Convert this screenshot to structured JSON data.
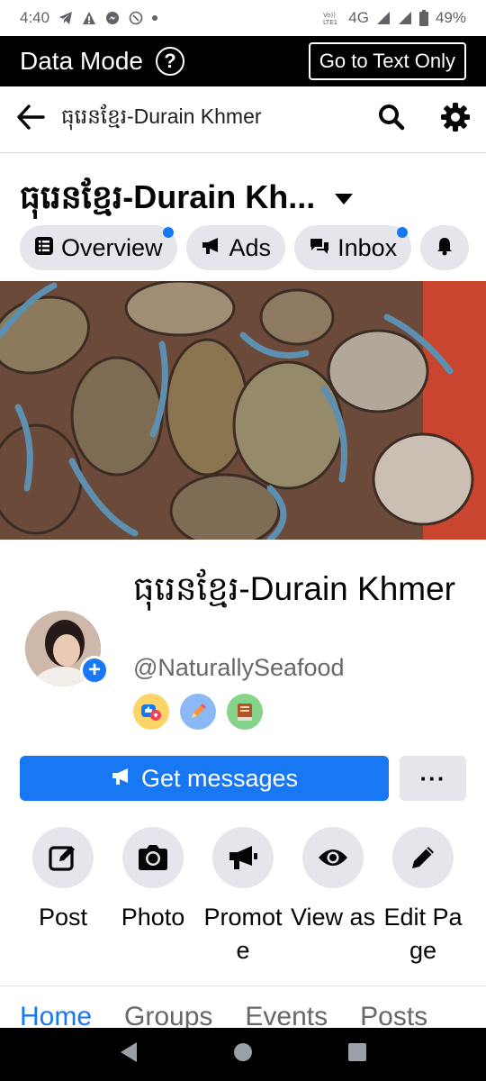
{
  "status_bar": {
    "time": "4:40",
    "network": "4G",
    "battery": "49%"
  },
  "data_mode": {
    "title": "Data Mode",
    "help_label": "?",
    "text_only_label": "Go to Text Only"
  },
  "search_bar": {
    "query": "ធុរេនខ្មែរ-Durain Khmer"
  },
  "page_header": {
    "title": "ធុរេនខ្មែរ-Durain Kh..."
  },
  "chips": [
    {
      "label": "Overview",
      "icon": "list-icon",
      "has_dot": true
    },
    {
      "label": "Ads",
      "icon": "megaphone-icon",
      "has_dot": false
    },
    {
      "label": "Inbox",
      "icon": "chat-icon",
      "has_dot": true
    }
  ],
  "profile": {
    "name": "ធុរេនខ្មែរ-Durain Khmer",
    "handle": "@NaturallySeafood",
    "badges": [
      "likes-badge",
      "pencil-badge",
      "book-badge"
    ]
  },
  "get_messages_label": "Get messages",
  "more_label": "···",
  "actions": [
    {
      "label": "Post",
      "icon": "edit-icon"
    },
    {
      "label": "Photo",
      "icon": "camera-icon"
    },
    {
      "label": "Promote",
      "icon": "megaphone-icon"
    },
    {
      "label": "View as",
      "icon": "eye-icon"
    },
    {
      "label": "Edit Page",
      "icon": "pencil-icon"
    }
  ],
  "tabs": [
    {
      "label": "Home",
      "active": true
    },
    {
      "label": "Groups",
      "active": false
    },
    {
      "label": "Events",
      "active": false
    },
    {
      "label": "Posts",
      "active": false
    }
  ],
  "colors": {
    "accent": "#1877f2",
    "chip_bg": "#e4e6eb",
    "secondary_text": "#65676b"
  }
}
